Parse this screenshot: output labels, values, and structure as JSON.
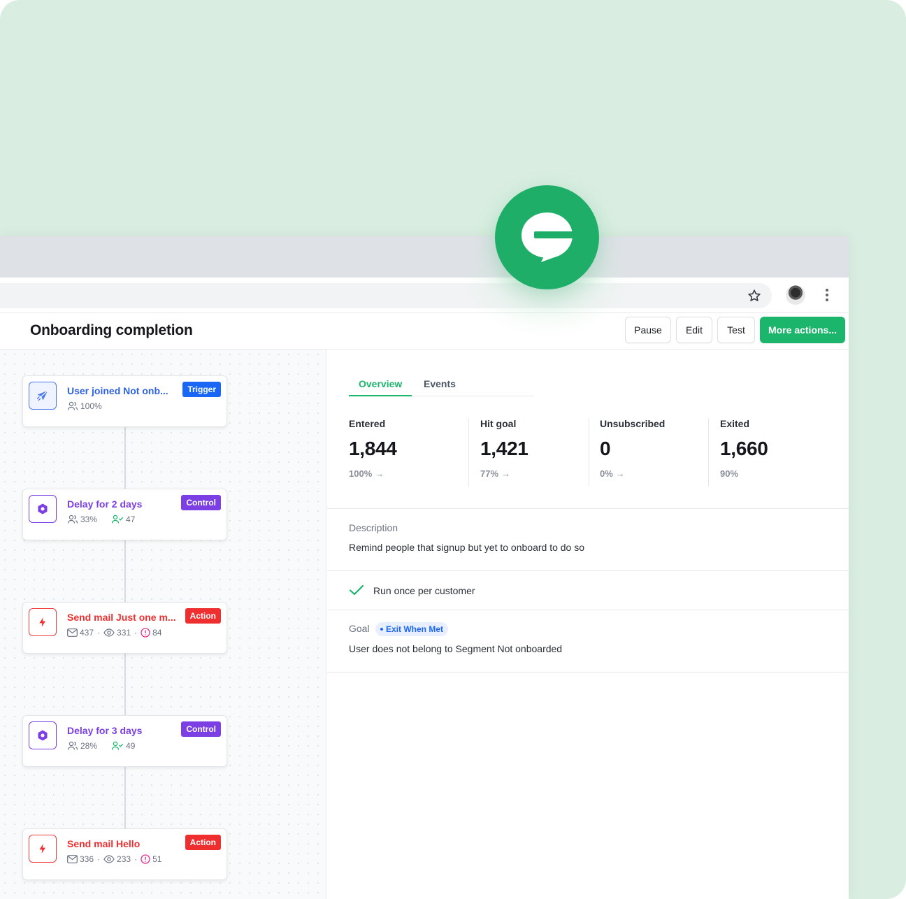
{
  "page": {
    "title": "Onboarding completion"
  },
  "header": {
    "pause": "Pause",
    "edit": "Edit",
    "test": "Test",
    "more": "More actions..."
  },
  "workflow": {
    "nodes": [
      {
        "title": "User joined Not onb...",
        "badge": "Trigger",
        "stat1": "100%"
      },
      {
        "title": "Delay for 2 days",
        "badge": "Control",
        "stat1": "33%",
        "stat2": "47"
      },
      {
        "title": "Send mail Just one m...",
        "badge": "Action",
        "sent": "437",
        "opened": "331",
        "failed": "84"
      },
      {
        "title": "Delay for 3 days",
        "badge": "Control",
        "stat1": "28%",
        "stat2": "49"
      },
      {
        "title": "Send mail Hello",
        "badge": "Action",
        "sent": "336",
        "opened": "233",
        "failed": "51"
      }
    ]
  },
  "tabs": {
    "overview": "Overview",
    "events": "Events"
  },
  "stats": [
    {
      "label": "Entered",
      "value": "1,844",
      "sub": "100%"
    },
    {
      "label": "Hit goal",
      "value": "1,421",
      "sub": "77%"
    },
    {
      "label": "Unsubscribed",
      "value": "0",
      "sub": "0%"
    },
    {
      "label": "Exited",
      "value": "1,660",
      "sub": "90%"
    }
  ],
  "description": {
    "label": "Description",
    "text": "Remind people that signup but yet to onboard to do so"
  },
  "run_once": "Run once per customer",
  "goal": {
    "label": "Goal",
    "pill": "Exit When Met",
    "text": "User does not belong to Segment Not onboarded"
  },
  "colors": {
    "brand": "#1bb56c",
    "trigger": "#1a66f5",
    "control": "#7b3fe4",
    "action": "#ef2f2f",
    "background": "#d9eee0"
  }
}
